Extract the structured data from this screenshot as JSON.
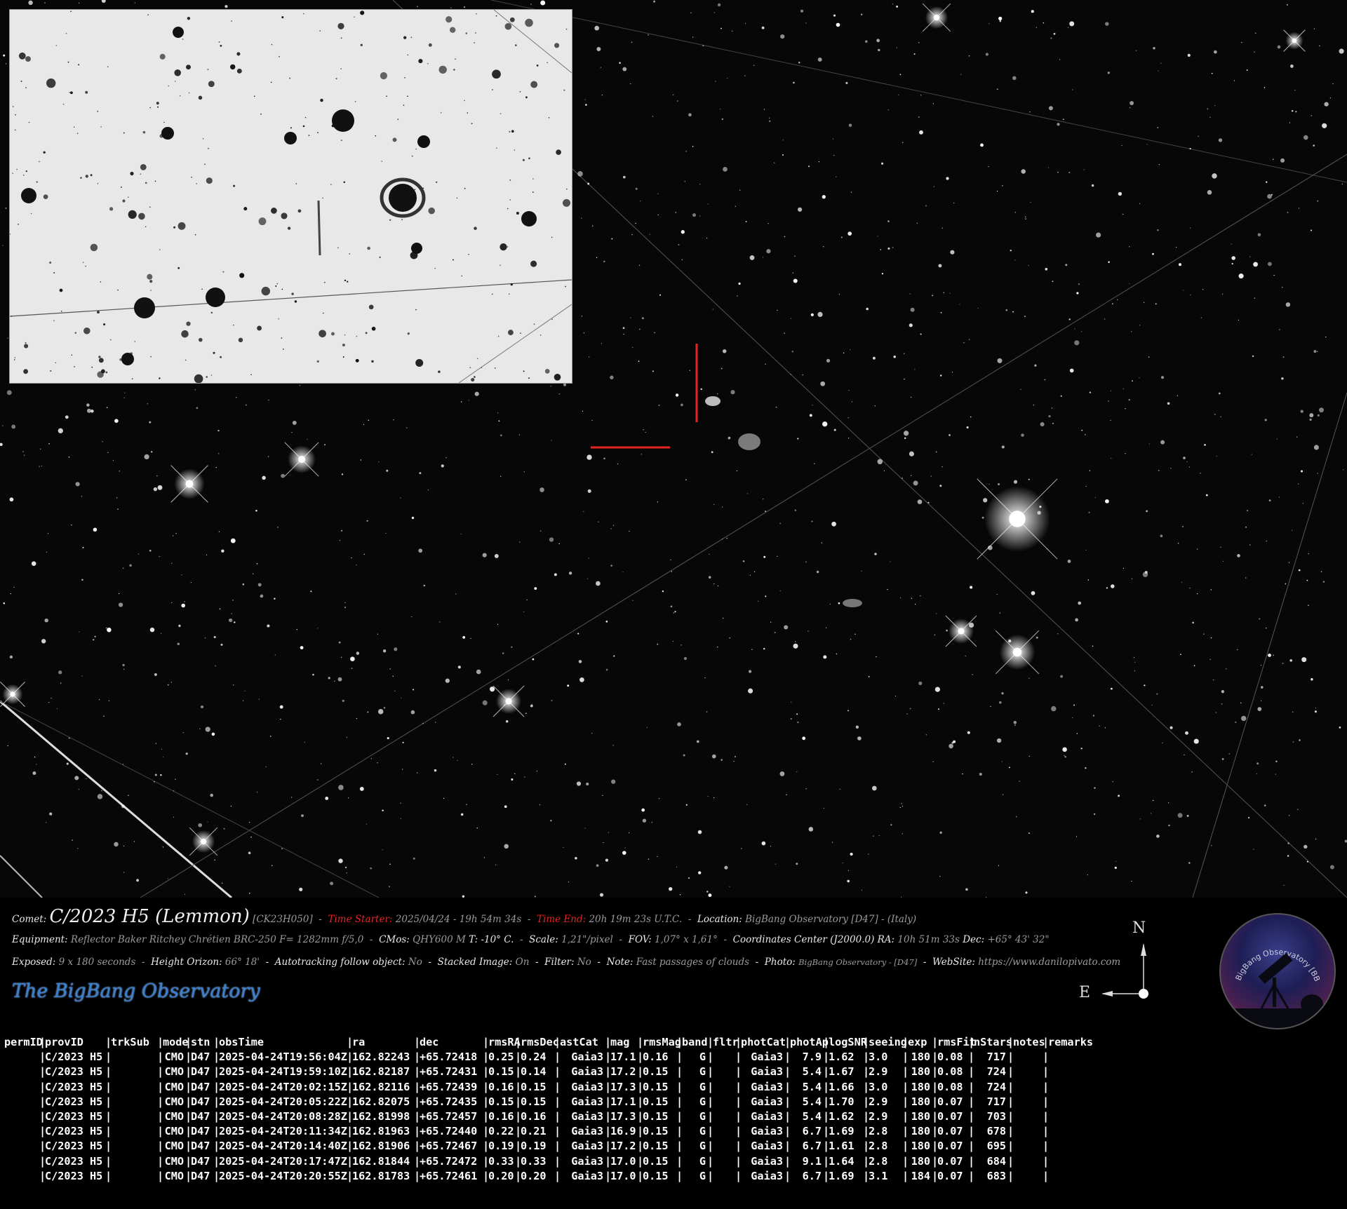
{
  "caption": {
    "comet_label": "Comet:",
    "comet_name": "C/2023 H5 (Lemmon)",
    "packed_designation": "[CK23H050]",
    "time_starter_label": "Time Starter:",
    "time_starter_value": "2025/04/24  -  19h 54m 34s",
    "time_end_label": "Time End:",
    "time_end_value": "20h 19m 23s U.T.C.",
    "location_label": "Location:",
    "location_value": "BigBang Observatory [D47] - (Italy)",
    "equipment_label": "Equipment:",
    "equipment_value": "Reflector Baker Ritchey Chrétien BRC-250  F= 1282mm f/5,0",
    "cmos_label": "CMos:",
    "cmos_value": "QHY600 M",
    "temp_value": "T: -10° C.",
    "scale_label": "Scale:",
    "scale_value": "1,21\"/pixel",
    "fov_label": "FOV:",
    "fov_value": "1,07° x 1,61°",
    "coords_label": "Coordinates Center (J2000.0) RA:",
    "ra_value": "10h 51m 33s",
    "dec_label": "Dec:",
    "dec_value": "+65° 43' 32\"",
    "exposed_label": "Exposed:",
    "exposed_value": "9 x 180 seconds",
    "height_label": "Height Orizon:",
    "height_value": "66° 18'",
    "autotrack_label": "Autotracking follow object:",
    "autotrack_value": "No",
    "stacked_label": "Stacked Image:",
    "stacked_value": "On",
    "filter_label": "Filter:",
    "filter_value": "No",
    "note_label": "Note:",
    "note_value": "Fast passages of clouds",
    "photo_label": "Photo:",
    "photo_value": "BigBang Observatory - [D47]",
    "website_label": "WebSite:",
    "website_value": "https://www.danilopivato.com",
    "brand": "The BigBang Observatory"
  },
  "compass": {
    "north": "N",
    "east": "E"
  },
  "logo": {
    "ring_text": "BigBang Observatory [BBO] - D47",
    "emblem": "telescope-silhouette"
  },
  "table": {
    "headers": [
      "permID",
      "provID",
      "trkSub",
      "mode",
      "stn",
      "obsTime",
      "ra",
      "dec",
      "rmsRA",
      "rmsDec",
      "astCat",
      "mag",
      "rmsMag",
      "band",
      "fltr",
      "photCat",
      "photAp",
      "logSNR",
      "seeing",
      "exp",
      "rmsFit",
      "nStars",
      "notes",
      "remarks"
    ],
    "rows": [
      [
        "",
        "C/2023 H5",
        "",
        "CMO",
        "D47",
        "2025-04-24T19:56:04Z",
        "162.82243",
        "+65.72418",
        "0.25",
        "0.24",
        "Gaia3",
        "17.1",
        "0.16",
        "G",
        "",
        "Gaia3",
        "7.9",
        "1.62",
        "3.0",
        "180",
        "0.08",
        "717",
        "",
        ""
      ],
      [
        "",
        "C/2023 H5",
        "",
        "CMO",
        "D47",
        "2025-04-24T19:59:10Z",
        "162.82187",
        "+65.72431",
        "0.15",
        "0.14",
        "Gaia3",
        "17.2",
        "0.15",
        "G",
        "",
        "Gaia3",
        "5.4",
        "1.67",
        "2.9",
        "180",
        "0.08",
        "724",
        "",
        ""
      ],
      [
        "",
        "C/2023 H5",
        "",
        "CMO",
        "D47",
        "2025-04-24T20:02:15Z",
        "162.82116",
        "+65.72439",
        "0.16",
        "0.15",
        "Gaia3",
        "17.3",
        "0.15",
        "G",
        "",
        "Gaia3",
        "5.4",
        "1.66",
        "3.0",
        "180",
        "0.08",
        "724",
        "",
        ""
      ],
      [
        "",
        "C/2023 H5",
        "",
        "CMO",
        "D47",
        "2025-04-24T20:05:22Z",
        "162.82075",
        "+65.72435",
        "0.15",
        "0.15",
        "Gaia3",
        "17.1",
        "0.15",
        "G",
        "",
        "Gaia3",
        "5.4",
        "1.70",
        "2.9",
        "180",
        "0.07",
        "717",
        "",
        ""
      ],
      [
        "",
        "C/2023 H5",
        "",
        "CMO",
        "D47",
        "2025-04-24T20:08:28Z",
        "162.81998",
        "+65.72457",
        "0.16",
        "0.16",
        "Gaia3",
        "17.3",
        "0.15",
        "G",
        "",
        "Gaia3",
        "5.4",
        "1.62",
        "2.9",
        "180",
        "0.07",
        "703",
        "",
        ""
      ],
      [
        "",
        "C/2023 H5",
        "",
        "CMO",
        "D47",
        "2025-04-24T20:11:34Z",
        "162.81963",
        "+65.72440",
        "0.22",
        "0.21",
        "Gaia3",
        "16.9",
        "0.15",
        "G",
        "",
        "Gaia3",
        "6.7",
        "1.69",
        "2.8",
        "180",
        "0.07",
        "678",
        "",
        ""
      ],
      [
        "",
        "C/2023 H5",
        "",
        "CMO",
        "D47",
        "2025-04-24T20:14:40Z",
        "162.81906",
        "+65.72467",
        "0.19",
        "0.19",
        "Gaia3",
        "17.2",
        "0.15",
        "G",
        "",
        "Gaia3",
        "6.7",
        "1.61",
        "2.8",
        "180",
        "0.07",
        "695",
        "",
        ""
      ],
      [
        "",
        "C/2023 H5",
        "",
        "CMO",
        "D47",
        "2025-04-24T20:17:47Z",
        "162.81844",
        "+65.72472",
        "0.33",
        "0.33",
        "Gaia3",
        "17.0",
        "0.15",
        "G",
        "",
        "Gaia3",
        "9.1",
        "1.64",
        "2.8",
        "180",
        "0.07",
        "684",
        "",
        ""
      ],
      [
        "",
        "C/2023 H5",
        "",
        "CMO",
        "D47",
        "2025-04-24T20:20:55Z",
        "162.81783",
        "+65.72461",
        "0.20",
        "0.20",
        "Gaia3",
        "17.0",
        "0.15",
        "G",
        "",
        "Gaia3",
        "6.7",
        "1.69",
        "3.1",
        "184",
        "0.07",
        "683",
        "",
        ""
      ]
    ]
  },
  "colors": {
    "marker": "#e52424",
    "brand": "#3a7fd0",
    "background": "#000000"
  }
}
